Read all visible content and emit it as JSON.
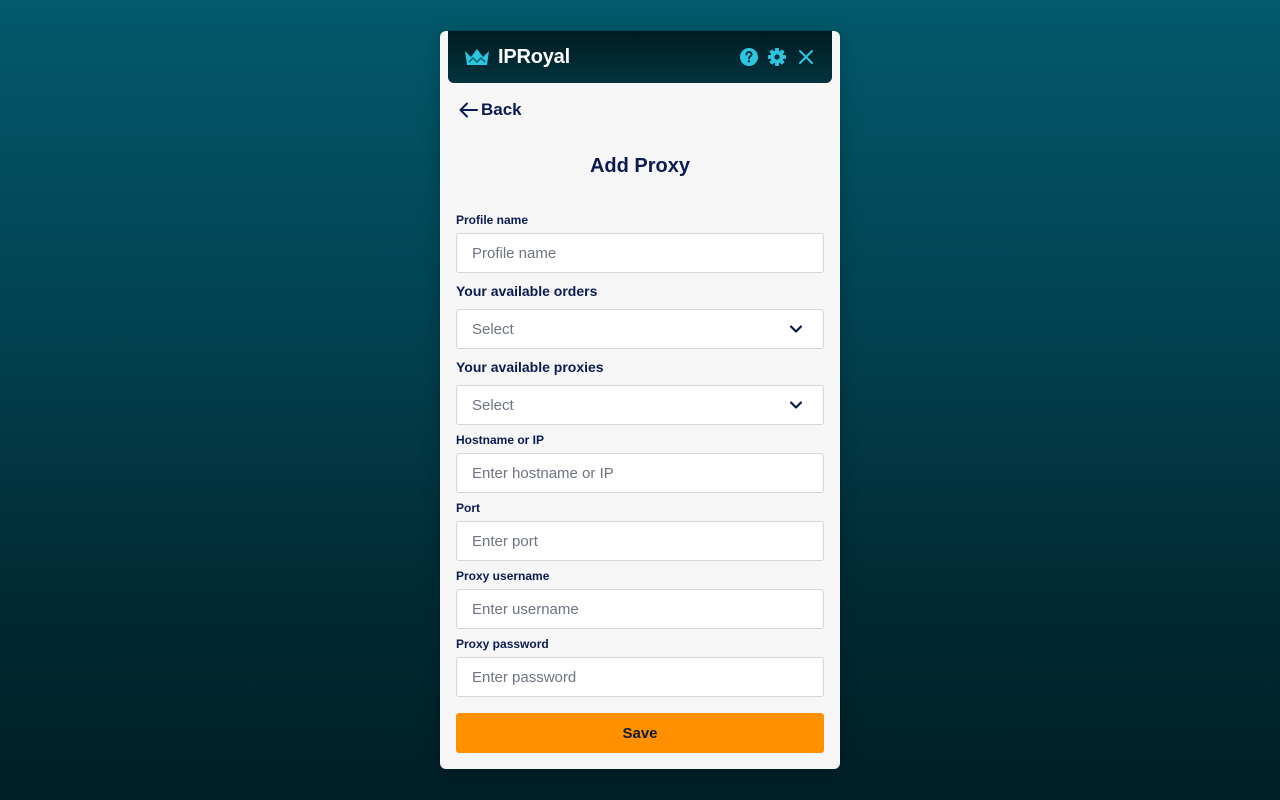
{
  "brand": {
    "name": "IPRoyal",
    "accent_color": "#2ec5e0",
    "logo_icon": "crown-icon"
  },
  "header": {
    "icons": [
      "help-icon",
      "gear-icon",
      "close-icon"
    ]
  },
  "nav": {
    "back_label": "Back",
    "back_icon": "arrow-left-icon"
  },
  "page": {
    "title": "Add Proxy"
  },
  "form": {
    "profile_name": {
      "label": "Profile name",
      "placeholder": "Profile name",
      "value": ""
    },
    "orders": {
      "label": "Your available orders",
      "selected": "Select"
    },
    "proxies": {
      "label": "Your available proxies",
      "selected": "Select"
    },
    "hostname": {
      "label": "Hostname or IP",
      "placeholder": "Enter hostname or IP",
      "value": ""
    },
    "port": {
      "label": "Port",
      "placeholder": "Enter port",
      "value": ""
    },
    "username": {
      "label": "Proxy username",
      "placeholder": "Enter username",
      "value": ""
    },
    "password": {
      "label": "Proxy password",
      "placeholder": "Enter password",
      "value": ""
    },
    "save_label": "Save"
  },
  "colors": {
    "primary_text": "#0b1b4f",
    "save_button": "#ff9100",
    "panel_background": "#f6f6f7"
  }
}
